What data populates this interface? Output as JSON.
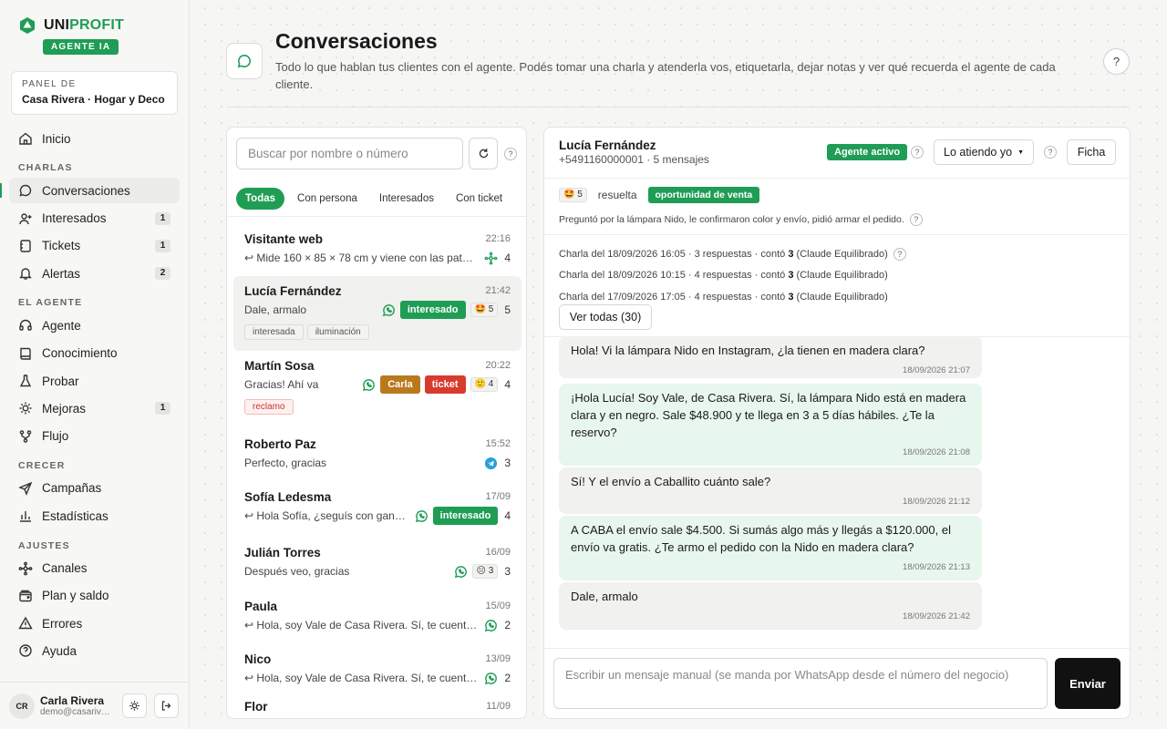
{
  "brand": {
    "name_a": "UNI",
    "name_b": "PROFIT",
    "badge": "AGENTE IA"
  },
  "panel": {
    "label": "PANEL DE",
    "value": "Casa Rivera · Hogar y Deco"
  },
  "nav": {
    "inicio": "Inicio",
    "sec_charlas": "CHARLAS",
    "conversaciones": "Conversaciones",
    "interesados": "Interesados",
    "interesados_count": "1",
    "tickets": "Tickets",
    "tickets_count": "1",
    "alertas": "Alertas",
    "alertas_count": "2",
    "sec_agente": "EL AGENTE",
    "agente": "Agente",
    "conocimiento": "Conocimiento",
    "probar": "Probar",
    "mejoras": "Mejoras",
    "mejoras_count": "1",
    "flujo": "Flujo",
    "sec_crecer": "CRECER",
    "campanas": "Campañas",
    "estadisticas": "Estadísticas",
    "sec_ajustes": "AJUSTES",
    "canales": "Canales",
    "plan": "Plan y saldo",
    "errores": "Errores",
    "ayuda": "Ayuda"
  },
  "user": {
    "initials": "CR",
    "name": "Carla Rivera",
    "email": "demo@casarivera.com"
  },
  "header": {
    "title": "Conversaciones",
    "subtitle": "Todo lo que hablan tus clientes con el agente. Podés tomar una charla y atenderla vos, etiquetarla, dejar notas y ver qué recuerda el agente de cada cliente.",
    "help": "?"
  },
  "list": {
    "search_placeholder": "Buscar por nombre o número",
    "filters": [
      "Todas",
      "Con persona",
      "Interesados",
      "Con ticket"
    ],
    "items": [
      {
        "name": "Visitante web",
        "time": "22:16",
        "preview": "↩ Mide 160 × 85 × 78 cm y viene con las patas en madera",
        "count": "4"
      },
      {
        "name": "Lucía Fernández",
        "time": "21:42",
        "preview": "Dale, armalo",
        "tag1": "interesado",
        "score": "5",
        "count": "5",
        "label1": "interesada",
        "label2": "iluminación"
      },
      {
        "name": "Martín Sosa",
        "time": "20:22",
        "preview": "Gracias! Ahí va",
        "tag1": "Carla",
        "tag2": "ticket",
        "score": "4",
        "count": "4",
        "label1": "reclamo"
      },
      {
        "name": "Roberto Paz",
        "time": "15:52",
        "preview": "Perfecto, gracias",
        "count": "3"
      },
      {
        "name": "Sofía Ledesma",
        "time": "17/09",
        "preview": "↩ Hola Sofía, ¿seguís con ganas de la mesa?",
        "tag1": "interesado",
        "count": "4"
      },
      {
        "name": "Julián Torres",
        "time": "16/09",
        "preview": "Después veo, gracias",
        "score": "3",
        "count": "3"
      },
      {
        "name": "Paula",
        "time": "15/09",
        "preview": "↩ Hola, soy Vale de Casa Rivera. Sí, te cuento que tenemos",
        "count": "2"
      },
      {
        "name": "Nico",
        "time": "13/09",
        "preview": "↩ Hola, soy Vale de Casa Rivera. Sí, te cuento que tenemos",
        "count": "2"
      },
      {
        "name": "Flor",
        "time": "11/09"
      }
    ]
  },
  "chat": {
    "name": "Lucía Fernández",
    "phone": "+5491160000001 · 5 mensajes",
    "agent_badge": "Agente activo",
    "attend": "Lo atiendo yo",
    "ficha": "Ficha",
    "summary_score": "5",
    "summary_status": "resuelta",
    "summary_tag": "oportunidad de venta",
    "summary_text": "Preguntó por la lámpara Nido, le confirmaron color y envío, pidió armar el pedido.",
    "history": [
      {
        "pre": "Charla del 18/09/2026 16:05 · 3 respuestas · contó ",
        "score": "3",
        "post": " (Claude Equilibrado)"
      },
      {
        "pre": "Charla del 18/09/2026 10:15 · 4 respuestas · contó ",
        "score": "3",
        "post": " (Claude Equilibrado)"
      },
      {
        "pre": "Charla del 17/09/2026 17:05 · 4 respuestas · contó ",
        "score": "3",
        "post": " (Claude Equilibrado)"
      }
    ],
    "all_btn": "Ver todas (30)",
    "messages": [
      {
        "dir": "in",
        "text": "Hola! Vi la lámpara Nido en Instagram, ¿la tienen en madera clara?",
        "time": "18/09/2026 21:07"
      },
      {
        "dir": "out",
        "text": "¡Hola Lucía! Soy Vale, de Casa Rivera. Sí, la lámpara Nido está en madera clara y en negro. Sale $48.900 y te llega en 3 a 5 días hábiles. ¿Te la reservo?",
        "time": "18/09/2026 21:08"
      },
      {
        "dir": "in",
        "text": "Sí! Y el envío a Caballito cuánto sale?",
        "time": "18/09/2026 21:12"
      },
      {
        "dir": "out",
        "text": "A CABA el envío sale $4.500. Si sumás algo más y llegás a $120.000, el envío va gratis. ¿Te armo el pedido con la Nido en madera clara?",
        "time": "18/09/2026 21:13"
      },
      {
        "dir": "in",
        "text": "Dale, armalo",
        "time": "18/09/2026 21:42"
      }
    ],
    "composer_placeholder": "Escribir un mensaje manual (se manda por WhatsApp desde el número del negocio)",
    "send": "Enviar"
  },
  "colors": {
    "accent": "#1f9d55",
    "amber": "#b97a1c",
    "red": "#d93a2e"
  }
}
